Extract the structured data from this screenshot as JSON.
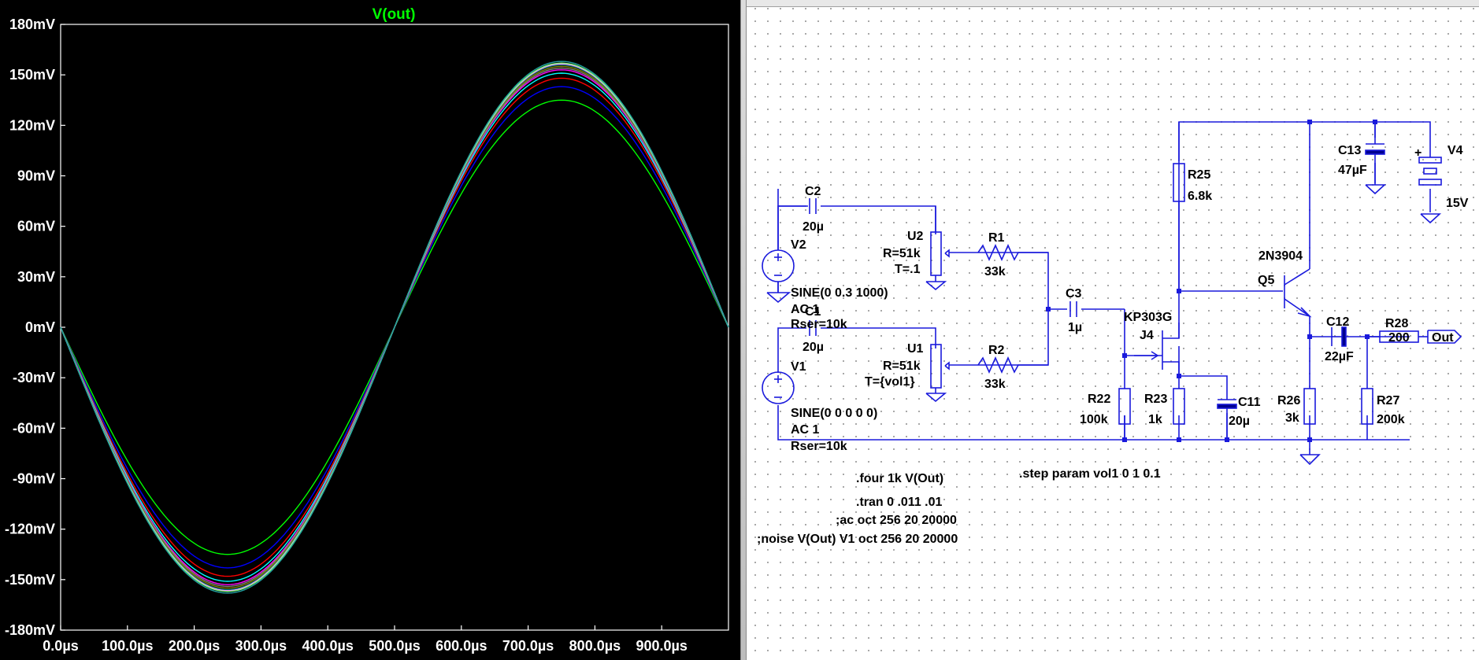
{
  "waveform": {
    "trace_title": "V(out)",
    "y_tick_labels": [
      "180mV",
      "150mV",
      "120mV",
      "90mV",
      "60mV",
      "30mV",
      "0mV",
      "-30mV",
      "-60mV",
      "-90mV",
      "-120mV",
      "-150mV",
      "-180mV"
    ],
    "x_tick_labels": [
      "0.0µs",
      "100.0µs",
      "200.0µs",
      "300.0µs",
      "400.0µs",
      "500.0µs",
      "600.0µs",
      "700.0µs",
      "800.0µs",
      "900.0µs"
    ],
    "colors": {
      "background": "#000000",
      "title": "#00ff00",
      "axis": "#ffffff"
    }
  },
  "chart_data": {
    "type": "line",
    "title": "V(out)",
    "xlabel": "",
    "ylabel": "",
    "x_unit": "µs",
    "y_unit": "mV",
    "xlim": [
      0,
      1000
    ],
    "ylim": [
      -180,
      180
    ],
    "grid": false,
    "waveform": "negative sine, period 1000 µs",
    "series": [
      {
        "color": "#00ff00",
        "amplitude": 135
      },
      {
        "color": "#0000ff",
        "amplitude": 143
      },
      {
        "color": "#ff0000",
        "amplitude": 148
      },
      {
        "color": "#00ffff",
        "amplitude": 151
      },
      {
        "color": "#ff00ff",
        "amplitude": 153
      },
      {
        "color": "#808080",
        "amplitude": 154
      },
      {
        "color": "#808000",
        "amplitude": 155
      },
      {
        "color": "#008080",
        "amplitude": 156
      },
      {
        "color": "#ff80ff",
        "amplitude": 156.5
      },
      {
        "color": "#80ff80",
        "amplitude": 157
      },
      {
        "color": "#20a0a0",
        "amplitude": 158
      }
    ]
  },
  "schematic": {
    "labels": {
      "c2_name": "C2",
      "c2_value": "20µ",
      "v2_name": "V2",
      "u2_name": "U2",
      "u2_r": "R=51k",
      "u2_t": "T=.1",
      "r1_name": "R1",
      "r1_value": "33k",
      "v2_source": "SINE(0 0.3 1000)",
      "v2_ac": "AC 1",
      "v2_rser": "Rser=10k",
      "c1_name": "C1",
      "c1_value": "20µ",
      "v1_name": "V1",
      "u1_name": "U1",
      "u1_r": "R=51k",
      "u1_t": "T={vol1}",
      "r2_name": "R2",
      "r2_value": "33k",
      "v1_source": "SINE(0 0 0 0 0)",
      "v1_ac": "AC 1",
      "v1_rser": "Rser=10k",
      "c3_name": "C3",
      "c3_value": "1µ",
      "j4_model": "KP303G",
      "j4_name": "J4",
      "r25_name": "R25",
      "r25_value": "6.8k",
      "q5_model": "2N3904",
      "q5_name": "Q5",
      "c13_name": "C13",
      "c13_value": "47µF",
      "v4_name": "V4",
      "v4_value": "15V",
      "c12_name": "C12",
      "c12_value": "22µF",
      "r28_name": "R28",
      "r28_value": "200",
      "out_label": "Out",
      "r22_name": "R22",
      "r22_value": "100k",
      "r23_name": "R23",
      "r23_value": "1k",
      "c11_name": "C11",
      "c11_value": "20µ",
      "r26_name": "R26",
      "r26_value": "3k",
      "r27_name": "R27",
      "r27_value": "200k",
      "plus_sign": "+"
    },
    "directives": {
      "four": ".four 1k  V(Out)",
      "tran": ".tran 0 .011 .01",
      "ac": ";ac oct 256 20 20000",
      "noise": ";noise V(Out) V1 oct 256 20 20000",
      "step": ".step param vol1 0 1 0.1"
    },
    "colors": {
      "wire": "#1a1adc",
      "text": "#000000"
    }
  }
}
